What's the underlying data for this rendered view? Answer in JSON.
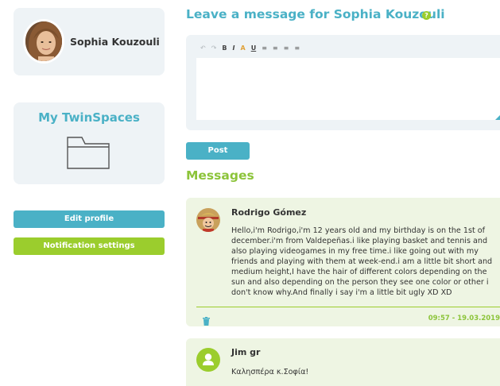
{
  "profile": {
    "name": "Sophia Kouzouli"
  },
  "twinspaces": {
    "title": "My TwinSpaces"
  },
  "sidebar_buttons": {
    "edit_profile": "Edit profile",
    "notification_settings": "Notification settings"
  },
  "compose": {
    "title": "Leave a message for Sophia Kouzouli",
    "help": "?",
    "post_label": "Post",
    "toolbar": [
      {
        "name": "undo-icon",
        "glyph": "↶"
      },
      {
        "name": "redo-icon",
        "glyph": "↷"
      },
      {
        "name": "bold-icon",
        "glyph": "B"
      },
      {
        "name": "italic-icon",
        "glyph": "I"
      },
      {
        "name": "text-color-icon",
        "glyph": "A"
      },
      {
        "name": "underline-icon",
        "glyph": "U"
      },
      {
        "name": "align-left-icon",
        "glyph": "≡"
      },
      {
        "name": "align-center-icon",
        "glyph": "≡"
      },
      {
        "name": "align-right-icon",
        "glyph": "≡"
      },
      {
        "name": "align-justify-icon",
        "glyph": "≡"
      }
    ]
  },
  "messages": {
    "title": "Messages",
    "items": [
      {
        "author": "Rodrigo Gómez",
        "body": "Hello,i'm Rodrigo,i'm 12 years old and my birthday is on the 1st of december.i'm from Valdepeñas.i like playing basket and tennis and also playing videogames in my free time.i like going out with my friends and playing with them at week-end.i am a little bit short and medium height,I have the hair of different colors depending on the sun and also depending on the person they see one color or other i don't know why.And finally i say i'm a little bit ugly XD XD",
        "time": "09:57 - 19.03.2019"
      },
      {
        "author": "Jim gr",
        "body": "Καλησπέρα κ.Σοφία!"
      }
    ]
  },
  "colors": {
    "teal": "#4ab1c6",
    "green": "#9bcd2d",
    "panel": "#eef3f6",
    "message_bg": "#eef5e3"
  }
}
